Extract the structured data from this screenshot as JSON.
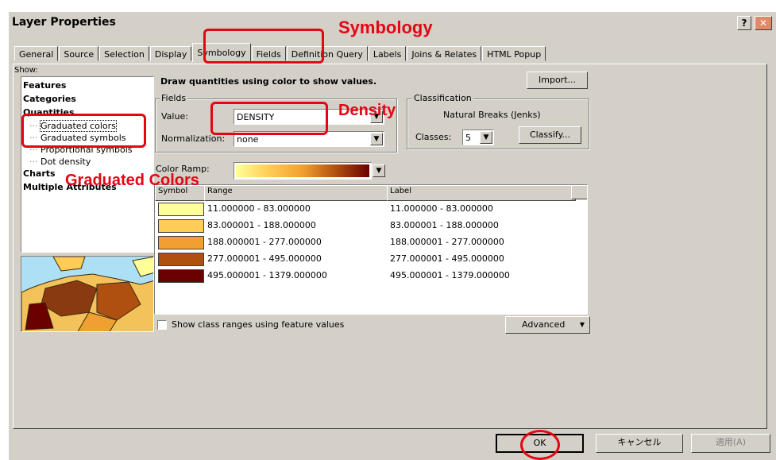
{
  "window": {
    "title": "Layer Properties",
    "help_glyph": "?",
    "close_glyph": "✕"
  },
  "tabs": [
    "General",
    "Source",
    "Selection",
    "Display",
    "Symbology",
    "Fields",
    "Definition Query",
    "Labels",
    "Joins & Relates",
    "HTML Popup"
  ],
  "active_tab": "Symbology",
  "show": {
    "label": "Show:",
    "items": [
      {
        "label": "Features",
        "level": 0
      },
      {
        "label": "Categories",
        "level": 0
      },
      {
        "label": "Quantities",
        "level": 0
      },
      {
        "label": "Graduated colors",
        "level": 1,
        "selected": true
      },
      {
        "label": "Graduated symbols",
        "level": 1
      },
      {
        "label": "Proportional symbols",
        "level": 1
      },
      {
        "label": "Dot density",
        "level": 1
      },
      {
        "label": "Charts",
        "level": 0
      },
      {
        "label": "Multiple Attributes",
        "level": 0
      }
    ]
  },
  "description": "Draw quantities using color to show values.",
  "import_button": "Import...",
  "fields": {
    "group_label": "Fields",
    "value_label": "Value:",
    "value": "DENSITY",
    "normalization_label": "Normalization:",
    "normalization": "none"
  },
  "classification": {
    "group_label": "Classification",
    "method": "Natural Breaks (Jenks)",
    "classes_label": "Classes:",
    "classes": "5",
    "classify_button": "Classify..."
  },
  "color_ramp": {
    "label": "Color Ramp:",
    "colors": [
      "#ffff99",
      "#ffcc55",
      "#f0a030",
      "#b05010",
      "#6a0000"
    ]
  },
  "table": {
    "headers": [
      "Symbol",
      "Range",
      "Label"
    ],
    "rows": [
      {
        "color": "#ffff99",
        "range": "11.000000 - 83.000000",
        "label": "11.000000 - 83.000000"
      },
      {
        "color": "#ffcc55",
        "range": "83.000001 - 188.000000",
        "label": "83.000001 - 188.000000"
      },
      {
        "color": "#f0a030",
        "range": "188.000001 - 277.000000",
        "label": "188.000001 - 277.000000"
      },
      {
        "color": "#b05010",
        "range": "277.000001 - 495.000000",
        "label": "277.000001 - 495.000000"
      },
      {
        "color": "#6a0000",
        "range": "495.000001 - 1379.000000",
        "label": "495.000001 - 1379.000000"
      }
    ]
  },
  "show_class_ranges": "Show class ranges using feature values",
  "advanced_button": "Advanced",
  "footer": {
    "ok": "OK",
    "cancel": "キャンセル",
    "apply": "適用(A)"
  },
  "annotations": {
    "symbology": "Symbology",
    "density": "Density",
    "graduated": "Graduated Colors"
  }
}
